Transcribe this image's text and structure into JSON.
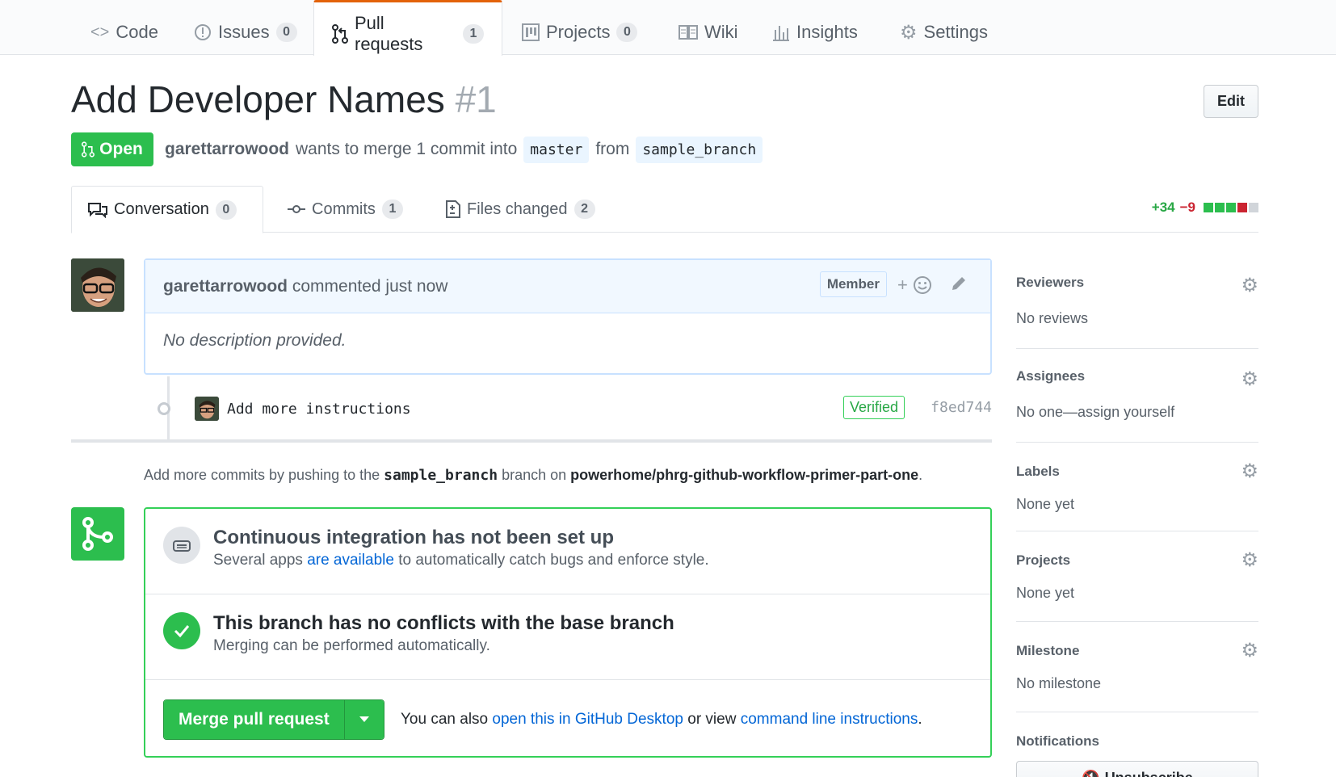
{
  "reponav": {
    "tabs": [
      {
        "label": "Code",
        "icon": "code-icon"
      },
      {
        "label": "Issues",
        "count": "0",
        "icon": "issue-icon"
      },
      {
        "label": "Pull requests",
        "count": "1",
        "icon": "pull-request-icon",
        "selected": true
      },
      {
        "label": "Projects",
        "count": "0",
        "icon": "project-icon"
      },
      {
        "label": "Wiki",
        "icon": "book-icon"
      },
      {
        "label": "Insights",
        "icon": "graph-icon"
      },
      {
        "label": "Settings",
        "icon": "gear-icon"
      }
    ]
  },
  "pr": {
    "title": "Add Developer Names",
    "number": "#1",
    "edit_label": "Edit",
    "state": "Open",
    "author": "garettarrowood",
    "merge_text": "wants to merge 1 commit into",
    "base_branch": "master",
    "from_text": "from",
    "head_branch": "sample_branch"
  },
  "tabs": {
    "conversation": {
      "label": "Conversation",
      "count": "0"
    },
    "commits": {
      "label": "Commits",
      "count": "1"
    },
    "files": {
      "label": "Files changed",
      "count": "2"
    },
    "additions": "+34",
    "deletions": "−9"
  },
  "comment": {
    "author": "garettarrowood",
    "action": "commented just now",
    "badge": "Member",
    "reaction_plus": "+",
    "body": "No description provided."
  },
  "commit": {
    "message": "Add more instructions",
    "verified": "Verified",
    "sha": "f8ed744"
  },
  "hint": {
    "prefix": "Add more commits by pushing to the",
    "branch": "sample_branch",
    "middle": "branch on",
    "repo": "powerhome/phrg-github-workflow-primer-part-one",
    "suffix": "."
  },
  "mergebox": {
    "ci_title": "Continuous integration has not been set up",
    "ci_sub_prefix": "Several apps",
    "ci_sub_link": "are available",
    "ci_sub_suffix": "to automatically catch bugs and enforce style.",
    "conflict_title": "This branch has no conflicts with the base branch",
    "conflict_sub": "Merging can be performed automatically.",
    "merge_button": "Merge pull request",
    "foot_prefix": "You can also",
    "foot_link1": "open this in GitHub Desktop",
    "foot_middle": "or view",
    "foot_link2": "command line instructions",
    "foot_suffix": "."
  },
  "sidebar": {
    "reviewers": {
      "heading": "Reviewers",
      "value": "No reviews"
    },
    "assignees": {
      "heading": "Assignees",
      "value": "No one—assign yourself"
    },
    "labels": {
      "heading": "Labels",
      "value": "None yet"
    },
    "projects": {
      "heading": "Projects",
      "value": "None yet"
    },
    "milestone": {
      "heading": "Milestone",
      "value": "No milestone"
    },
    "notifications": {
      "heading": "Notifications",
      "button": "Unsubscribe"
    }
  },
  "colors": {
    "open_green": "#2cbe4e",
    "link_blue": "#0366d6",
    "addition_green": "#28a745",
    "deletion_red": "#cb2431",
    "selected_tab_accent": "#e36209"
  }
}
